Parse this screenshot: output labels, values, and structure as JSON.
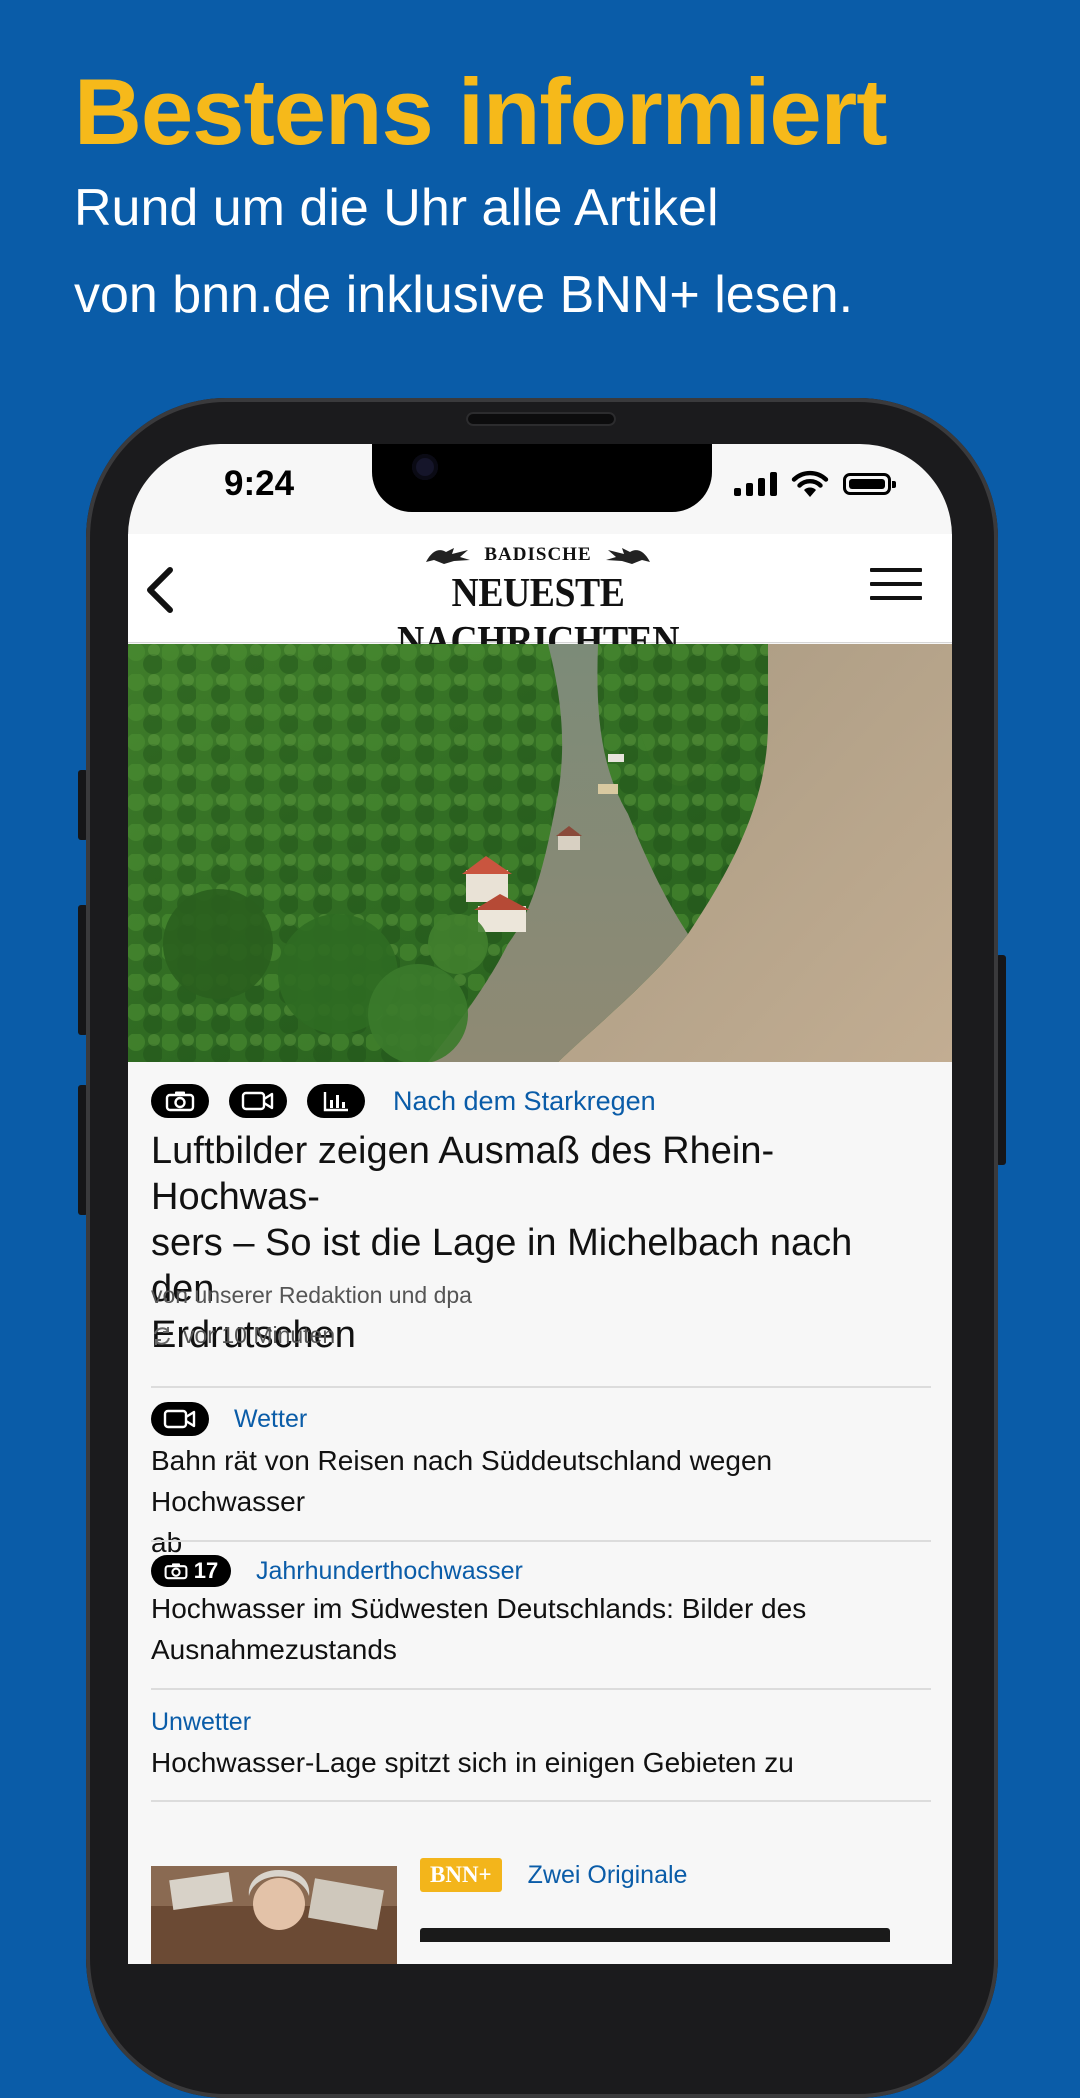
{
  "promo": {
    "headline": "Bestens informiert",
    "subline_1": "Rund um die Uhr alle Artikel",
    "subline_2": "von bnn.de inklusive BNN+ lesen."
  },
  "status_bar": {
    "time": "9:24",
    "icons": [
      "cellular-signal-icon",
      "wifi-icon",
      "battery-icon"
    ]
  },
  "app_header": {
    "logo_top": "BADISCHE",
    "logo_main": "NEUESTE NACHRICHTEN",
    "icons": [
      "back-icon",
      "menu-icon"
    ]
  },
  "lead_article": {
    "media_icons": [
      "camera-icon",
      "video-icon",
      "chart-icon"
    ],
    "kicker": "Nach dem Starkregen",
    "title_line_1": "Luftbilder zeigen Ausmaß des Rhein-Hochwas-",
    "title_line_2": "sers – So ist die Lage in Michelbach nach den",
    "title_line_3": "Erdrutschen",
    "author": "von unserer Redaktion und dpa",
    "time": "vor 10 Minuten"
  },
  "articles": [
    {
      "media_icon": "video-icon",
      "kicker": "Wetter",
      "title_line_1": "Bahn rät von Reisen nach Süddeutschland wegen Hochwasser",
      "title_line_2": "ab"
    },
    {
      "media_icon": "camera-icon",
      "photo_count": "17",
      "kicker": "Jahrhunderthochwasser",
      "title_line_1": "Hochwasser im Südwesten Deutschlands: Bilder des",
      "title_line_2": "Ausnahmezustands"
    },
    {
      "kicker": "Unwetter",
      "title_line_1": "Hochwasser-Lage spitzt sich in einigen Gebieten zu"
    },
    {
      "badge": "BNN+",
      "kicker": "Zwei Originale"
    }
  ],
  "colors": {
    "background": "#0a5ca8",
    "headline": "#f6b91a",
    "kicker": "#0a5ca8",
    "bnn_plus_badge": "#f3b51b"
  }
}
